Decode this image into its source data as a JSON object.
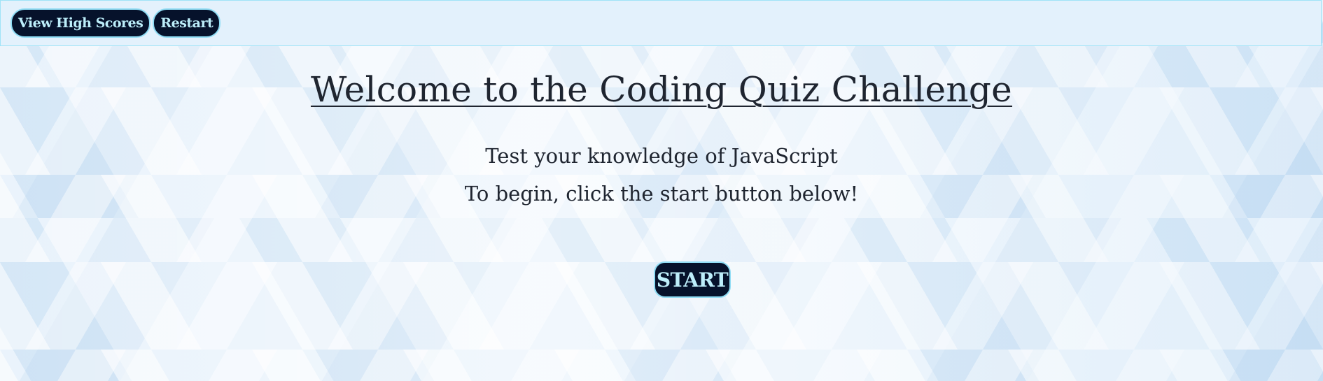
{
  "header": {
    "high_scores_label": "View High Scores",
    "restart_label": "Restart"
  },
  "main": {
    "title": "Welcome to the Coding Quiz Challenge",
    "subtitle_line1": "Test your knowledge of JavaScript",
    "subtitle_line2": "To begin, click the start button below!",
    "start_label": "START"
  },
  "colors": {
    "button_bg": "#06122b",
    "button_text": "#bdeefa",
    "button_border": "#8fdcf4",
    "header_bg": "#e3f1fc",
    "text": "#1f2530"
  }
}
